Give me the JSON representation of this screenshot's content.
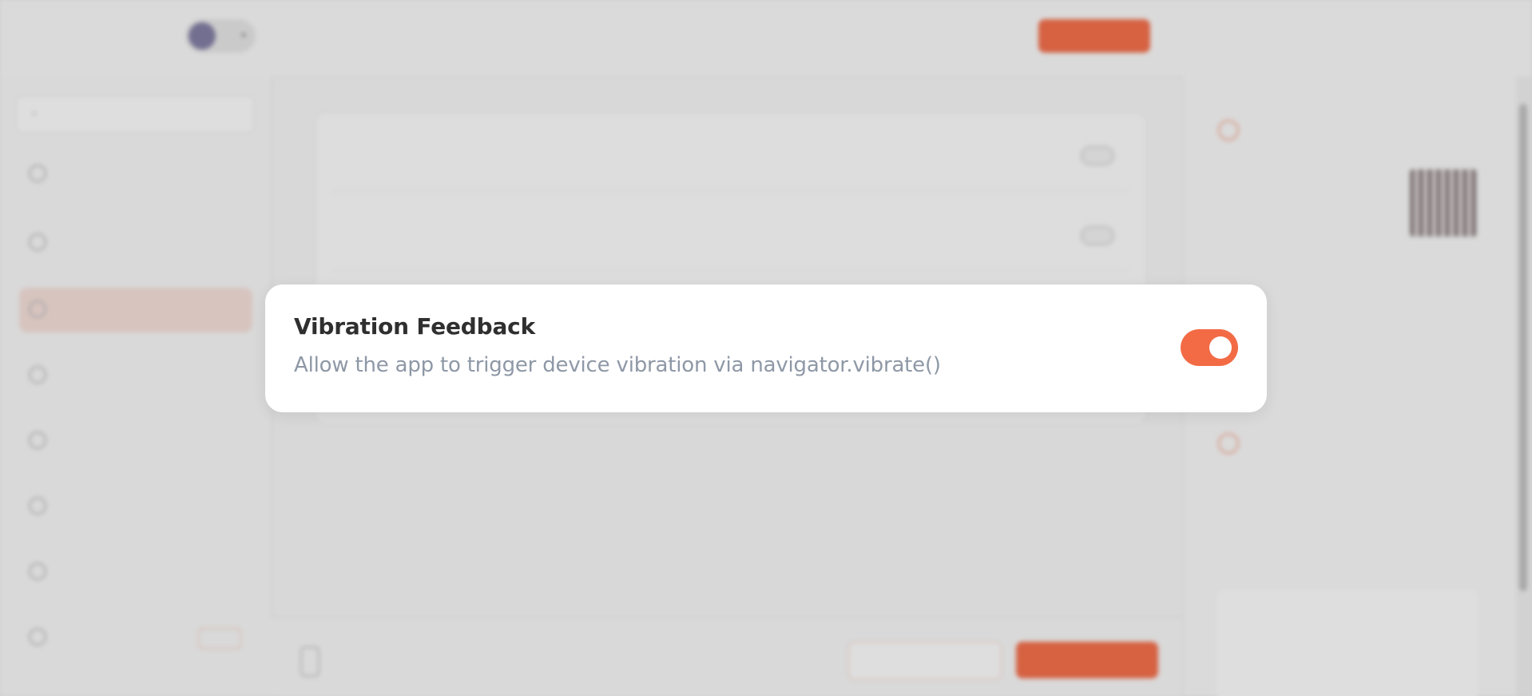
{
  "header": {
    "logo": "",
    "breadcrumb_small": "",
    "breadcrumb_title": "",
    "buy_label": "",
    "right_text": ""
  },
  "sidebar": {
    "search_placeholder": "",
    "items": [
      {
        "label": "",
        "icon": "apple-icon"
      },
      {
        "label": "",
        "icon": "phone-icon"
      },
      {
        "label": "",
        "icon": "permissions-icon",
        "active": true
      },
      {
        "label": "",
        "icon": "settings-icon"
      },
      {
        "label": "",
        "icon": "link-icon"
      },
      {
        "label": "",
        "icon": "overrides-icon"
      },
      {
        "label": "",
        "icon": "code-icon"
      },
      {
        "label": "",
        "icon": "add-ons-icon",
        "badge": ""
      }
    ]
  },
  "main": {
    "rows": [
      {
        "title": "",
        "desc": ""
      },
      {
        "title": "",
        "desc": ""
      }
    ]
  },
  "bottom": {
    "small": "",
    "main": "",
    "outline_button": "",
    "fill_button": ""
  },
  "right_panel": {
    "download": {
      "title": "",
      "desc": "",
      "link": ""
    },
    "sections": [
      {
        "title": "",
        "desc": ""
      },
      {
        "title": "",
        "desc": ""
      }
    ],
    "card": {
      "title": "",
      "desc": ""
    }
  },
  "modal": {
    "title": "Vibration Feedback",
    "description": "Allow the app to trigger device vibration via navigator.vibrate()",
    "toggle_on": true
  },
  "colors": {
    "accent": "#f26b45",
    "modal_title": "#2f2f2f",
    "modal_desc": "#8e98a6",
    "background": "#e9e9e9"
  }
}
